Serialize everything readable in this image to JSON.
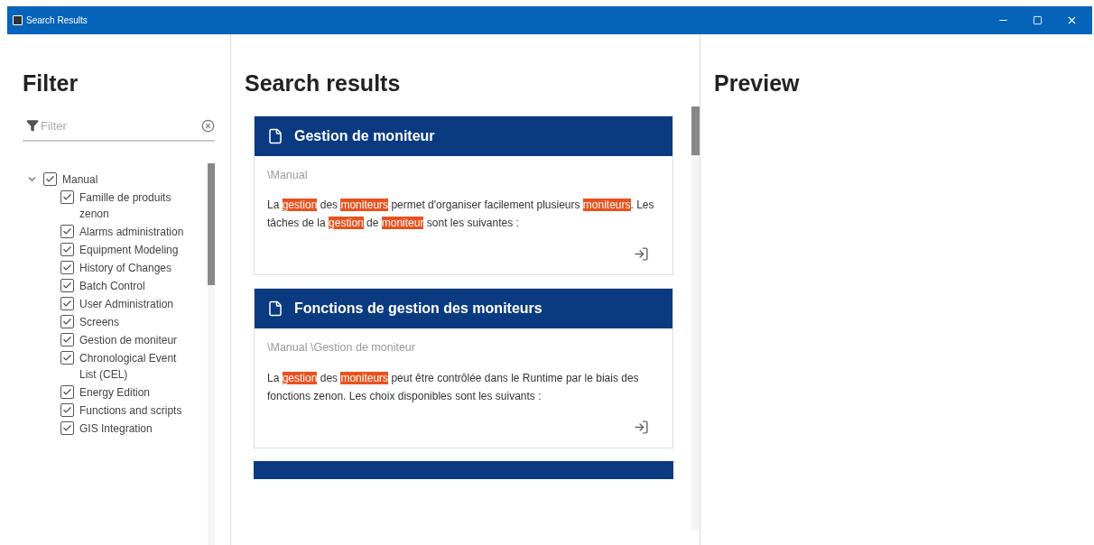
{
  "window": {
    "title": "Search Results"
  },
  "filter": {
    "heading": "Filter",
    "placeholder": "Filter",
    "tree": [
      {
        "label": "Manual",
        "checked": true,
        "expanded": true,
        "children": [
          {
            "label": "Famille de produits zenon",
            "checked": true
          },
          {
            "label": "Alarms administration",
            "checked": true
          },
          {
            "label": "Equipment Modeling",
            "checked": true
          },
          {
            "label": "History of Changes",
            "checked": true
          },
          {
            "label": "Batch Control",
            "checked": true
          },
          {
            "label": "User Administration",
            "checked": true
          },
          {
            "label": "Screens",
            "checked": true
          },
          {
            "label": "Gestion de moniteur",
            "checked": true
          },
          {
            "label": "Chronological Event List (CEL)",
            "checked": true
          },
          {
            "label": "Energy Edition",
            "checked": true
          },
          {
            "label": "Functions and scripts",
            "checked": true
          },
          {
            "label": "GIS Integration",
            "checked": true
          }
        ]
      }
    ]
  },
  "results": {
    "heading": "Search results",
    "more_below": true,
    "items": [
      {
        "title": "Gestion de moniteur",
        "path": "\\Manual",
        "snippet": [
          {
            "text": "La ",
            "highlight": false
          },
          {
            "text": "gestion",
            "highlight": true
          },
          {
            "text": " des ",
            "highlight": false
          },
          {
            "text": "moniteurs",
            "highlight": true
          },
          {
            "text": " permet d'organiser facilement plusieurs ",
            "highlight": false
          },
          {
            "text": "moniteurs",
            "highlight": true
          },
          {
            "text": ". Les tâches de la ",
            "highlight": false
          },
          {
            "text": "gestion",
            "highlight": true
          },
          {
            "text": " de ",
            "highlight": false
          },
          {
            "text": "moniteur",
            "highlight": true
          },
          {
            "text": " sont les suivantes :",
            "highlight": false
          }
        ]
      },
      {
        "title": "Fonctions de gestion des moniteurs",
        "path": "\\Manual \\Gestion de moniteur",
        "snippet": [
          {
            "text": "La ",
            "highlight": false
          },
          {
            "text": "gestion",
            "highlight": true
          },
          {
            "text": " des ",
            "highlight": false
          },
          {
            "text": "moniteurs",
            "highlight": true
          },
          {
            "text": " peut être contrôlée dans le Runtime par le biais des fonctions zenon. Les choix disponibles sont les suivants :",
            "highlight": false
          }
        ]
      }
    ]
  },
  "preview": {
    "heading": "Preview"
  }
}
